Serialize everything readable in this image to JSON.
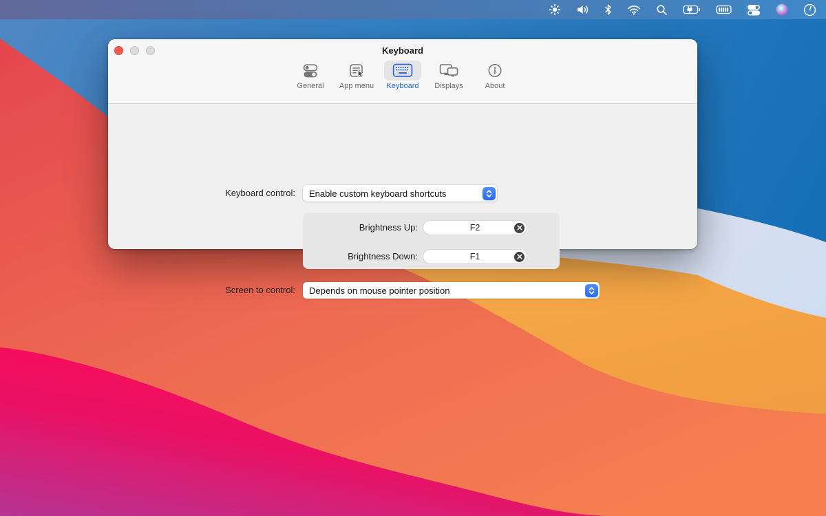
{
  "menubar": {
    "icons": [
      {
        "name": "brightness"
      },
      {
        "name": "volume"
      },
      {
        "name": "bluetooth"
      },
      {
        "name": "wifi"
      },
      {
        "name": "search"
      },
      {
        "name": "battery-charging"
      },
      {
        "name": "battery-level"
      },
      {
        "name": "control-center"
      },
      {
        "name": "siri"
      },
      {
        "name": "clock"
      }
    ]
  },
  "window": {
    "title": "Keyboard",
    "traffic_lights": [
      "close",
      "minimize",
      "zoom"
    ],
    "tabs": [
      {
        "label": "General",
        "selected": false
      },
      {
        "label": "App menu",
        "selected": false
      },
      {
        "label": "Keyboard",
        "selected": true
      },
      {
        "label": "Displays",
        "selected": false
      },
      {
        "label": "About",
        "selected": false
      }
    ],
    "content": {
      "keyboard_control": {
        "label": "Keyboard control:",
        "value": "Enable custom keyboard shortcuts"
      },
      "shortcuts": {
        "brightness_up": {
          "label": "Brightness Up:",
          "value": "F2"
        },
        "brightness_down": {
          "label": "Brightness Down:",
          "value": "F1"
        }
      },
      "screen_to_control": {
        "label": "Screen to control:",
        "value": "Depends on mouse pointer position"
      }
    }
  },
  "colors": {
    "accent_blue": "#2a6bf2",
    "selected_tab_blue": "#2468e4",
    "traffic_close_red": "#f2594f",
    "window_bg": "#f1f0f0",
    "toolbar_bg": "#f7f6f6",
    "groupbox_bg": "#e8e7e7",
    "menubar_left": "#62689b",
    "menubar_right": "#3f88c8",
    "wallpaper_blue": "#2e7fc2",
    "wallpaper_cream": "#dfe3ef",
    "wallpaper_yellow": "#f4a343",
    "wallpaper_red": "#ee6b52",
    "wallpaper_pink": "#fb0c58",
    "wallpaper_purple": "#b63493"
  }
}
